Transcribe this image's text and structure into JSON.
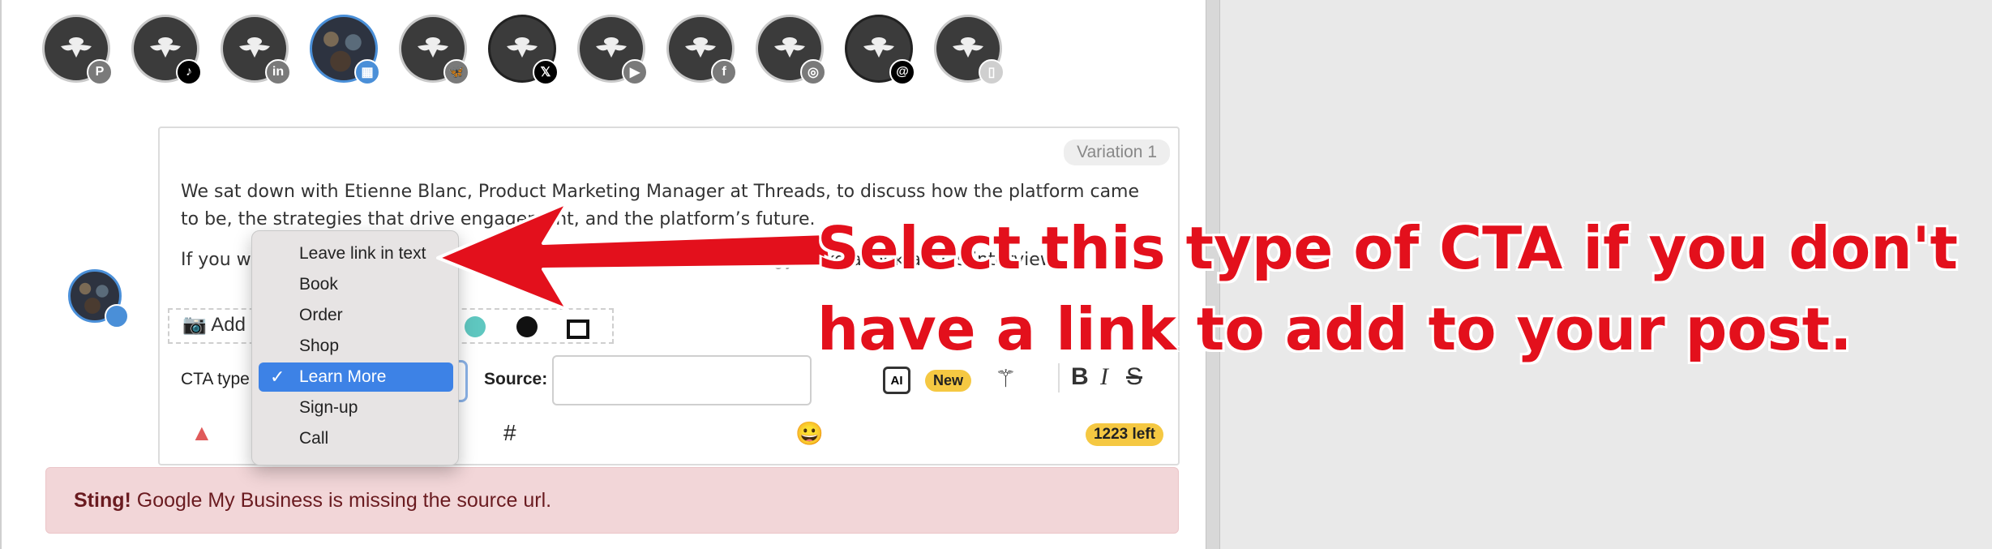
{
  "profiles": [
    {
      "name": "pinterest",
      "badge": "P"
    },
    {
      "name": "tiktok",
      "badge": "♪"
    },
    {
      "name": "linkedin",
      "badge": "in"
    },
    {
      "name": "google-business",
      "badge": "▦"
    },
    {
      "name": "bluesky",
      "badge": "🦋"
    },
    {
      "name": "x",
      "badge": "𝕏"
    },
    {
      "name": "youtube",
      "badge": "▶"
    },
    {
      "name": "facebook",
      "badge": "f"
    },
    {
      "name": "instagram",
      "badge": "◎"
    },
    {
      "name": "threads",
      "badge": "@"
    },
    {
      "name": "mobile",
      "badge": "▯"
    }
  ],
  "editor": {
    "variation_label": "Variation 1",
    "paragraph1": "We sat down with Etienne Blanc, Product Marketing Manager at Threads, to discuss how the platform came to be, the strategies that drive engagement, and the platform’s future.",
    "paragraph2": "If you want to learn more about how to create your Threads strategy, take a look at this interview.",
    "add_media_label": "Add",
    "cta_label": "CTA type",
    "source_label": "Source:",
    "source_value": "",
    "new_badge": "New",
    "chars_left": "1223 left"
  },
  "cta_options": [
    "Leave link in text",
    "Book",
    "Order",
    "Shop",
    "Learn More",
    "Sign-up",
    "Call"
  ],
  "cta_selected": "Learn More",
  "alert": {
    "strong": "Sting!",
    "text": " Google My Business is missing the source url."
  },
  "annotation": {
    "line1": "Select this type of CTA if you don't",
    "line2": "have a link to add to your post."
  },
  "colors": {
    "accent": "#3d82e6",
    "annotation": "#e3101c",
    "badge": "#f5c842",
    "alert_bg": "#f2d6d8"
  }
}
